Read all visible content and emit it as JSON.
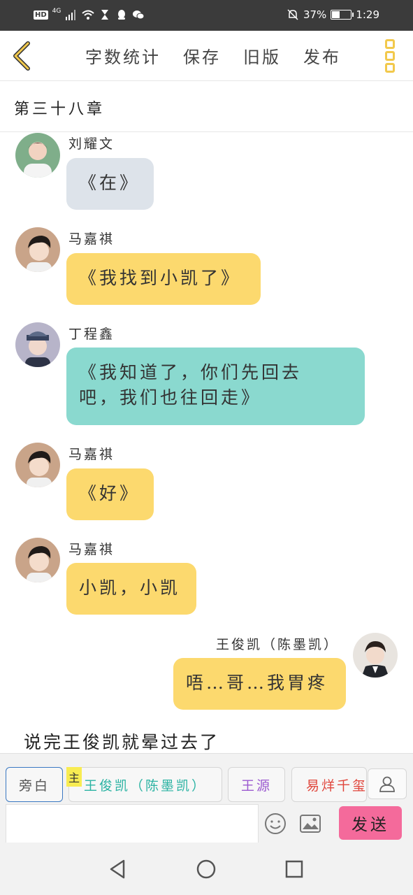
{
  "status_bar": {
    "hd": "HD",
    "network": "4G",
    "battery_text": "37%",
    "battery_level": 0.37,
    "time": "1:29"
  },
  "toolbar": {
    "items": [
      "字数统计",
      "保存",
      "旧版",
      "发布"
    ],
    "back_icon": "chevron-left-icon",
    "more_icon": "three-dots-vertical-icon",
    "accent": "#f2c94c"
  },
  "chapter": {
    "title": "第三十八章"
  },
  "messages": [
    {
      "sender": "刘耀文",
      "text": "《在》",
      "color": "#dde3ea"
    },
    {
      "sender": "马嘉祺",
      "text": "《我找到小凯了》",
      "color": "#fcd96e"
    },
    {
      "sender": "丁程鑫",
      "text_line1": "《我知道了，你们先回去",
      "text_line2": "吧，我们也往回走》",
      "color": "#8ad9cf"
    },
    {
      "sender": "马嘉祺",
      "text": "《好》",
      "color": "#fcd96e"
    },
    {
      "sender": "马嘉祺",
      "text": "小凯，小凯",
      "color": "#fcd96e"
    },
    {
      "sender": "王俊凯（陈墨凯）",
      "text": "唔…哥…我胃疼",
      "color": "#fcd96e"
    }
  ],
  "narration": "说完王俊凯就晕过去了",
  "composer": {
    "roles": [
      {
        "label": "旁白",
        "color": "#555555"
      },
      {
        "label": "王俊凯（陈墨凯）",
        "color": "#2bb3a3"
      },
      {
        "label": "王源",
        "color": "#9b59d0"
      },
      {
        "label": "易烊千玺",
        "color": "#e0463c"
      }
    ],
    "main_tag": "主",
    "send_label": "发送",
    "input_value": "",
    "person_icon": "person-icon",
    "emoji_icon": "smiley-icon",
    "image_icon": "image-icon"
  },
  "nav": {
    "back": "back-triangle-icon",
    "home": "home-circle-icon",
    "recents": "recents-square-icon"
  }
}
